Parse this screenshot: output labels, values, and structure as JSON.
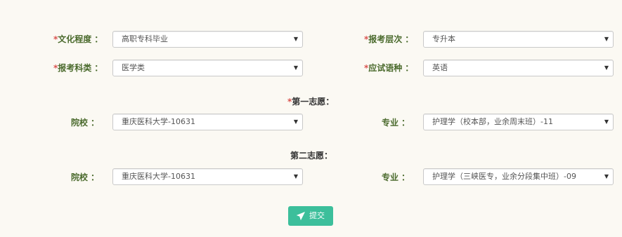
{
  "form": {
    "education": {
      "required_mark": "*",
      "label": "文化程度",
      "colon": "：",
      "value": "高职专科毕业"
    },
    "level": {
      "required_mark": "*",
      "label": "报考层次",
      "colon": "：",
      "value": "专升本"
    },
    "category": {
      "required_mark": "*",
      "label": "报考科类",
      "colon": "：",
      "value": "医学类"
    },
    "language": {
      "required_mark": "*",
      "label": "应试语种",
      "colon": "：",
      "value": "英语"
    }
  },
  "first_choice": {
    "required_mark": "*",
    "title": "第一志愿：",
    "school_label": "院校",
    "school_colon": "：",
    "school_value": "重庆医科大学-10631",
    "major_label": "专业",
    "major_colon": "：",
    "major_value": "护理学（校本部，业余周末班）-11"
  },
  "second_choice": {
    "title": "第二志愿：",
    "school_label": "院校",
    "school_colon": "：",
    "school_value": "重庆医科大学-10631",
    "major_label": "专业",
    "major_colon": "：",
    "major_value": "护理学（三峡医专，业余分段集中班）-09"
  },
  "submit": {
    "label": "提交",
    "icon": "send-icon"
  },
  "colors": {
    "accent": "#3cbf9b",
    "label_green": "#4a6a2c",
    "required_red": "#d9534f",
    "background": "#fbf9f3"
  },
  "dropdown_caret": "▼"
}
